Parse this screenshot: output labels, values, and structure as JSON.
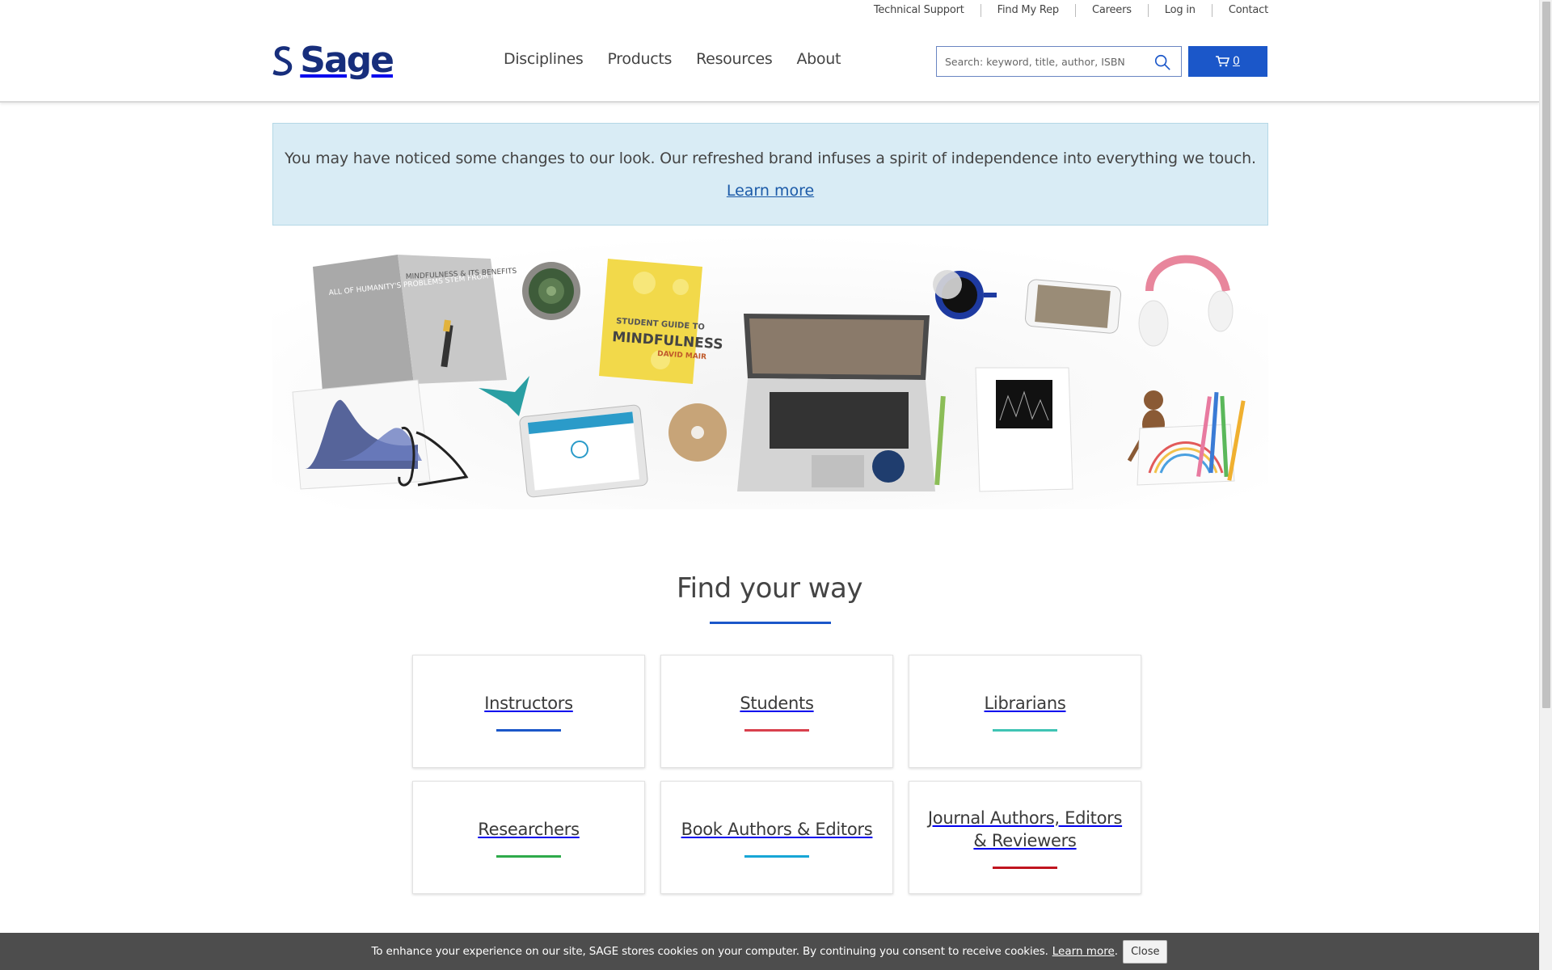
{
  "utility_nav": [
    "Technical Support",
    "Find My Rep",
    "Careers",
    "Log in",
    "Contact"
  ],
  "logo": {
    "text": "Sage",
    "color": "#172e7c"
  },
  "main_nav": [
    "Disciplines",
    "Products",
    "Resources",
    "About"
  ],
  "search": {
    "placeholder": "Search: keyword, title, author, ISBN",
    "icon": "search-icon"
  },
  "cart": {
    "count": "0",
    "icon": "cart-icon",
    "color": "#1b57c9"
  },
  "banner": {
    "message": "You may have noticed some changes to our look. Our refreshed brand infuses a spirit of independence into everything we touch.",
    "link": "Learn more"
  },
  "hero": {
    "book_title": "STUDENT GUIDE TO MINDFULNESS",
    "book_author": "DAVID MAIR",
    "open_book_left": "ALL OF HUMANITY'S PROBLEMS STEM FROM MAN'S INABILITY TO SIT QUIETLY IN A ROOM ALONE",
    "open_book_right": "MINDFULNESS & ITS BENEFITS"
  },
  "find_your_way": {
    "title": "Find your way",
    "cards": [
      {
        "label": "Instructors",
        "color": "#1b57c9"
      },
      {
        "label": "Students",
        "color": "#d9404d"
      },
      {
        "label": "Librarians",
        "color": "#3fc4b4"
      },
      {
        "label": "Researchers",
        "color": "#2eaa4a"
      },
      {
        "label": "Book Authors & Editors",
        "color": "#17a6d6"
      },
      {
        "label": "Journal Authors, Editors & Reviewers",
        "color": "#c0141f"
      }
    ]
  },
  "cookie": {
    "text": "To enhance your experience on our site, SAGE stores cookies on your computer. By continuing you consent to receive cookies.",
    "link": "Learn more",
    "close": "Close"
  }
}
